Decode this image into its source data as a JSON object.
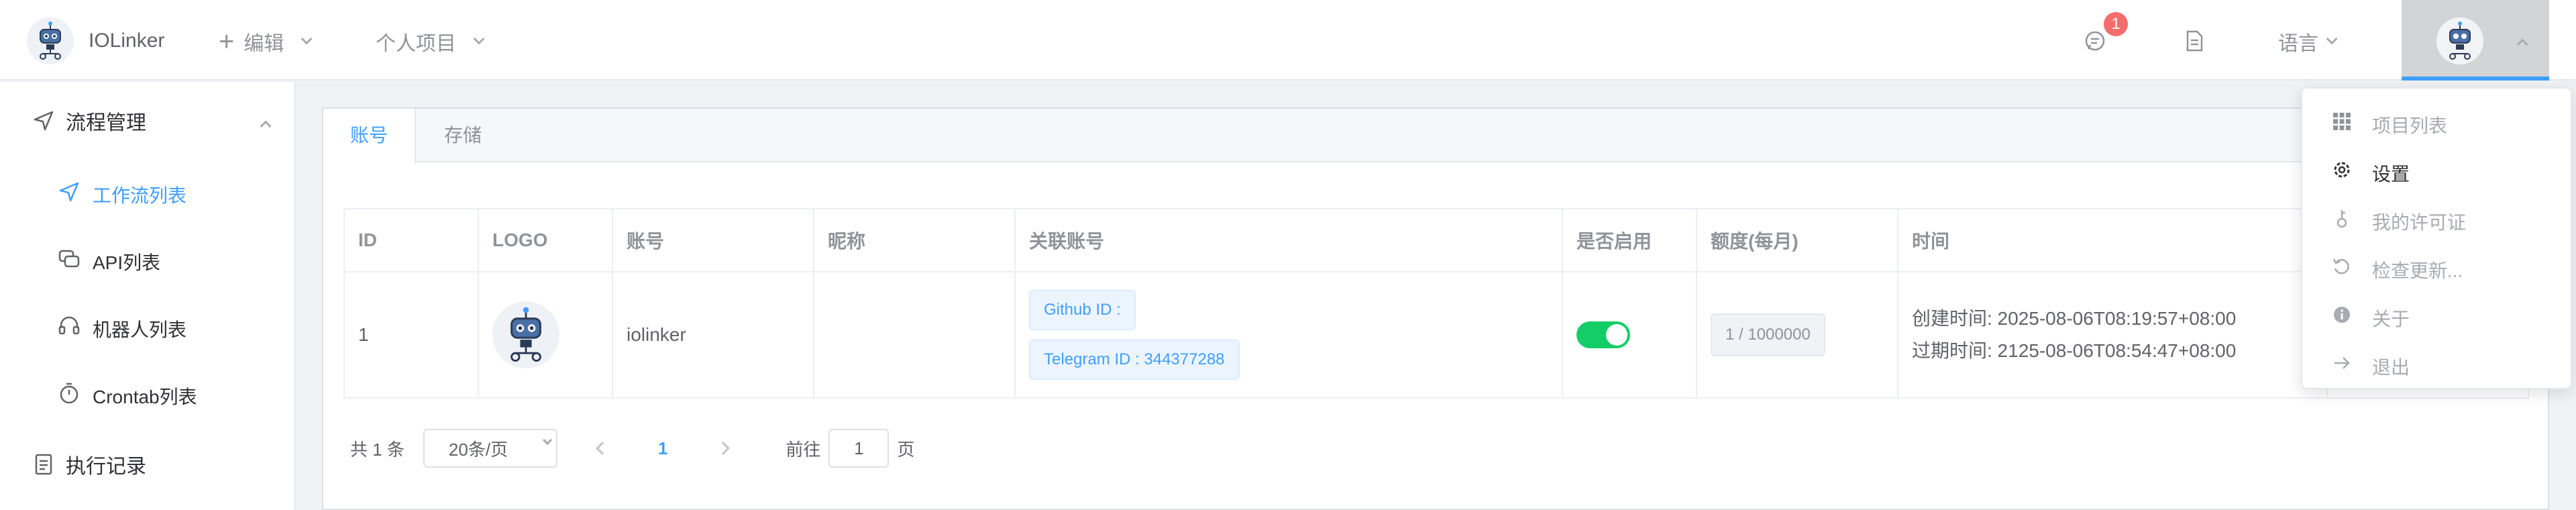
{
  "header": {
    "app_title": "IOLinker",
    "edit_menu": "编辑",
    "project_menu": "个人项目",
    "message_badge": "1",
    "language_menu": "语言"
  },
  "sidebar": {
    "groups": [
      {
        "label": "流程管理",
        "items": [
          {
            "label": "工作流列表",
            "active": true
          },
          {
            "label": "API列表"
          },
          {
            "label": "机器人列表"
          },
          {
            "label": "Crontab列表"
          }
        ]
      },
      {
        "label": "执行记录"
      }
    ]
  },
  "tabs": [
    {
      "label": "账号",
      "active": true
    },
    {
      "label": "存储"
    }
  ],
  "table": {
    "headers": [
      "ID",
      "LOGO",
      "账号",
      "昵称",
      "关联账号",
      "是否启用",
      "额度(每月)",
      "时间"
    ],
    "rows": [
      {
        "id": "1",
        "account": "iolinker",
        "nickname": "",
        "linked": [
          "Github ID :",
          "Telegram ID : 344377288"
        ],
        "enabled": true,
        "quota": "1 / 1000000",
        "created": "创建时间: 2025-08-06T08:19:57+08:00",
        "expires": "过期时间: 2125-08-06T08:54:47+08:00"
      }
    ]
  },
  "pagination": {
    "total": "共 1 条",
    "page_size": "20条/页",
    "current_page": "1",
    "goto_label": "前往",
    "goto_value": "1",
    "page_suffix": "页"
  },
  "user_menu": [
    {
      "label": "项目列表",
      "icon": "grid-icon"
    },
    {
      "label": "设置",
      "icon": "gear-icon"
    },
    {
      "label": "我的许可证",
      "icon": "key-icon"
    },
    {
      "label": "检查更新...",
      "icon": "refresh-icon"
    },
    {
      "label": "关于",
      "icon": "info-icon"
    },
    {
      "label": "退出",
      "icon": "arrow-right-icon"
    }
  ],
  "colors": {
    "accent": "#409eff",
    "switch_on": "#13ce66",
    "badge": "#f56c6c"
  }
}
